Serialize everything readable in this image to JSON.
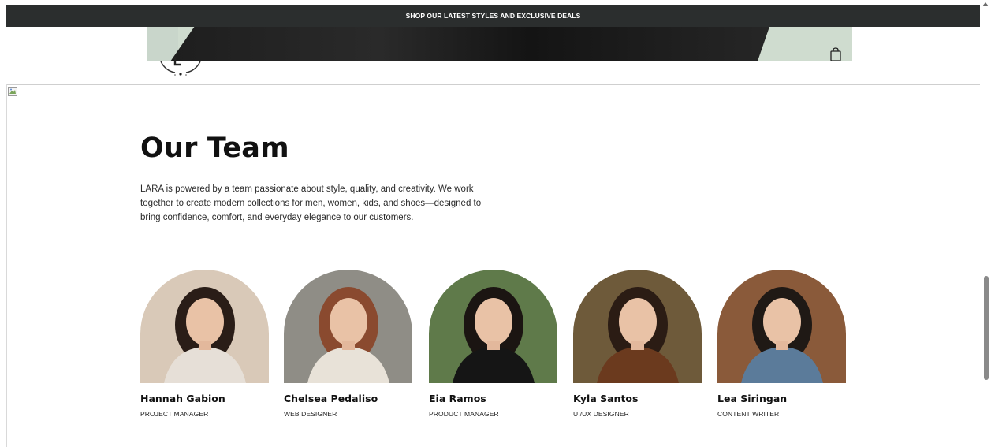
{
  "announcement": {
    "text": "SHOP OUR LATEST STYLES AND EXCLUSIVE DEALS"
  },
  "header": {
    "logo_icon": "lara-monogram-logo",
    "cart_icon": "shopping-bag-icon"
  },
  "team": {
    "title": "Our Team",
    "description": "LARA is powered by a team passionate about style, quality, and creativity. We work together to create modern collections for men, women, kids, and shoes—designed to bring confidence, comfort, and everyday elegance to our customers.",
    "members": [
      {
        "name": "Hannah Gabion",
        "role": "PROJECT MANAGER",
        "bg": "#d9c9b8",
        "hair": "#2a1d17",
        "top": "#e6dfd7"
      },
      {
        "name": "Chelsea Pedaliso",
        "role": "WEB DESIGNER",
        "bg": "#8f8d86",
        "hair": "#8a4a2f",
        "top": "#e8e2d8"
      },
      {
        "name": "Eia Ramos",
        "role": "PRODUCT MANAGER",
        "bg": "#5f7a4a",
        "hair": "#1b1512",
        "top": "#151515"
      },
      {
        "name": "Kyla Santos",
        "role": "UI/UX DESIGNER",
        "bg": "#6e5a3a",
        "hair": "#2b1c14",
        "top": "#6b3a1e"
      },
      {
        "name": "Lea Siringan",
        "role": "CONTENT WRITER",
        "bg": "#8a5a3a",
        "hair": "#1f1915",
        "top": "#5b7b9a"
      }
    ]
  }
}
